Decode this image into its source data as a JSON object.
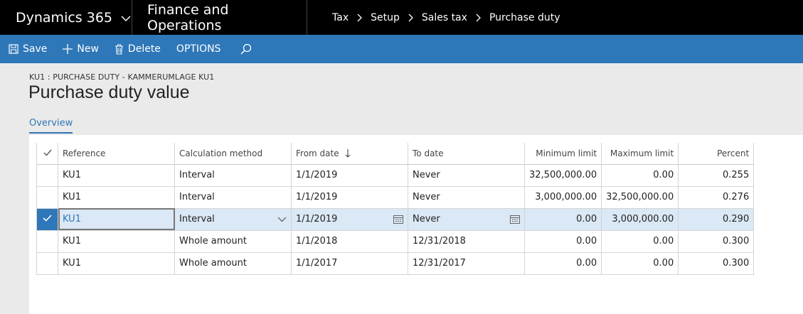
{
  "topbar": {
    "brand": "Dynamics 365",
    "app": "Finance and Operations",
    "breadcrumbs": [
      "Tax",
      "Setup",
      "Sales tax",
      "Purchase duty"
    ]
  },
  "actions": {
    "save": "Save",
    "new": "New",
    "delete": "Delete",
    "options": "OPTIONS"
  },
  "page": {
    "caption": "KU1 : PURCHASE DUTY - KAMMERUMLAGE KU1",
    "title": "Purchase duty value",
    "tab": "Overview"
  },
  "grid": {
    "headers": {
      "reference": "Reference",
      "method": "Calculation method",
      "from": "From date",
      "to": "To date",
      "min": "Minimum limit",
      "max": "Maximum limit",
      "percent": "Percent"
    },
    "rows": [
      {
        "reference": "KU1",
        "method": "Interval",
        "from": "1/1/2019",
        "to": "Never",
        "min": "32,500,000.00",
        "max": "0.00",
        "percent": "0.255"
      },
      {
        "reference": "KU1",
        "method": "Interval",
        "from": "1/1/2019",
        "to": "Never",
        "min": "3,000,000.00",
        "max": "32,500,000.00",
        "percent": "0.276"
      },
      {
        "reference": "KU1",
        "method": "Interval",
        "from": "1/1/2019",
        "to": "Never",
        "min": "0.00",
        "max": "3,000,000.00",
        "percent": "0.290"
      },
      {
        "reference": "KU1",
        "method": "Whole amount",
        "from": "1/1/2018",
        "to": "12/31/2018",
        "min": "0.00",
        "max": "0.00",
        "percent": "0.300"
      },
      {
        "reference": "KU1",
        "method": "Whole amount",
        "from": "1/1/2017",
        "to": "12/31/2017",
        "min": "0.00",
        "max": "0.00",
        "percent": "0.300"
      }
    ]
  },
  "colors": {
    "topbar": "#000000",
    "actionbar": "#2e77b8",
    "accent": "#2e77b8",
    "selected_row": "#dbe8f5"
  }
}
